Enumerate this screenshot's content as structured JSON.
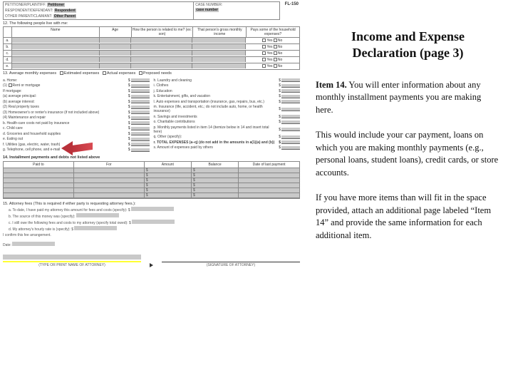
{
  "form": {
    "code": "FL-150",
    "header": {
      "petitioner_label": "PETITIONER/PLAINTIFF:",
      "petitioner_value": "Petitioner",
      "respondent_label": "RESPONDENT/DEFENDANT:",
      "respondent_value": "Respondent",
      "other_label": "OTHER PARENT/CLAIMANT:",
      "other_value": "Other Parent",
      "case_label": "CASE NUMBER:",
      "case_value": "case number"
    },
    "sec12": {
      "title": "12.  The following people live with me:",
      "cols": [
        "Name",
        "Age",
        "How the person is related to me? (ex: son)",
        "That person's gross monthly income",
        "Pays some of the household expenses?"
      ],
      "rows_labels": [
        "a.",
        "b.",
        "c.",
        "d.",
        "e."
      ],
      "yes": "Yes",
      "no": "No"
    },
    "sec13": {
      "title": "13.  Average monthly expenses",
      "opt1": "Estimated expenses",
      "opt2": "Actual expenses",
      "opt3": "Proposed needs",
      "left": [
        {
          "k": "a.",
          "t": "Home:"
        },
        {
          "k": "(1)",
          "t": "Rent or   mortgage",
          "cb": true
        },
        {
          "k": "",
          "t": "If mortgage:"
        },
        {
          "k": "(a)",
          "t": "average principal:"
        },
        {
          "k": "(b)",
          "t": "average interest:"
        },
        {
          "k": "(2)",
          "t": "Real property taxes"
        },
        {
          "k": "(3)",
          "t": "Homeowner's or renter's insurance (if not included above)"
        },
        {
          "k": "(4)",
          "t": "Maintenance and repair"
        },
        {
          "k": "b.",
          "t": "Health-care costs not paid by insurance"
        },
        {
          "k": "c.",
          "t": "Child care"
        },
        {
          "k": "d.",
          "t": "Groceries and household supplies"
        },
        {
          "k": "e.",
          "t": "Eating out"
        },
        {
          "k": "f.",
          "t": "Utilities (gas, electric, water, trash)"
        },
        {
          "k": "g.",
          "t": "Telephone, cell phone, and e-mail"
        }
      ],
      "right": [
        {
          "k": "h.",
          "t": "Laundry and cleaning"
        },
        {
          "k": "i.",
          "t": "Clothes"
        },
        {
          "k": "j.",
          "t": "Education"
        },
        {
          "k": "k.",
          "t": "Entertainment, gifts, and vacation"
        },
        {
          "k": "l.",
          "t": "Auto expenses and transportation (insurance, gas, repairs, bus, etc.)"
        },
        {
          "k": "m.",
          "t": "Insurance (life, accident, etc.; do not include auto, home, or health insurance)"
        },
        {
          "k": "n.",
          "t": "Savings and investments"
        },
        {
          "k": "o.",
          "t": "Charitable contributions"
        },
        {
          "k": "p.",
          "t": "Monthly payments listed in item 14 (itemize below in 14 and insert total here)"
        },
        {
          "k": "q.",
          "t": "Other (specify):"
        },
        {
          "k": "r.",
          "t": "TOTAL EXPENSES (a–q) (do not add in the amounts in a(1)(a) and (b))",
          "bold": true
        },
        {
          "k": "s.",
          "t": "Amount of expenses paid by others"
        }
      ]
    },
    "sec14": {
      "title": "14.  Installment payments and debts not listed above",
      "cols": [
        "Paid to",
        "For",
        "Amount",
        "Balance",
        "Date of last payment"
      ],
      "rows": 6
    },
    "sec15": {
      "title": "15.  Attorney fees (This is required if either party is requesting attorney fees.):",
      "lines": [
        "a.  To date, I have paid my attorney this amount for fees and costs (specify): $",
        "b.  The source of this money was (specify):",
        "c.  I still owe the following fees and costs to my attorney (specify total owed): $",
        "d.  My attorney's hourly rate is (specify): $"
      ],
      "confirm": "I confirm this fee arrangement."
    },
    "footer": {
      "date_label": "Date:",
      "type_name": "(TYPE OR PRINT NAME OF ATTORNEY)",
      "sig": "(SIGNATURE OF ATTORNEY)"
    }
  },
  "panel": {
    "title_line1": "Income and Expense",
    "title_line2": "Declaration (page 3)",
    "p1_a": "Item 14.",
    "p1_b": "  You will enter information about any monthly installment payments you are making here.",
    "p2": "This would include your car payment, loans on which you are making monthly payments (e.g., personal loans, student loans), credit cards, or store accounts.",
    "p3": "If you have more items than will fit in the space provided,  attach an additional page labeled “Item 14” and provide the same information for each additional item."
  }
}
